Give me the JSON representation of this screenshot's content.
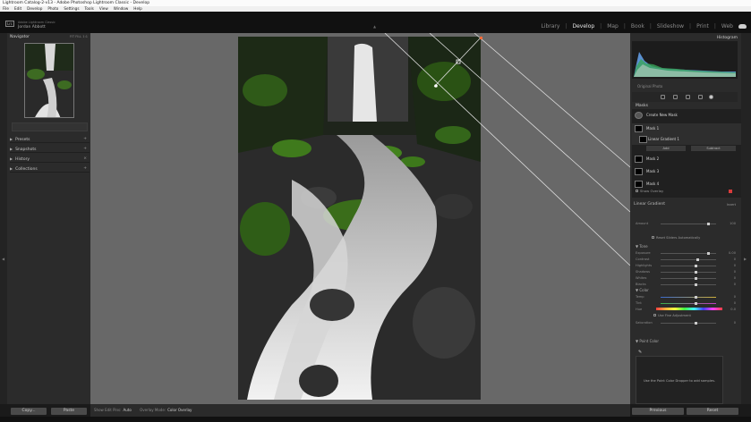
{
  "titlebar": {
    "title": "Lightroom Catalog-2-v13 - Adobe Photoshop Lightroom Classic - Develop"
  },
  "menu": [
    "File",
    "Edit",
    "Develop",
    "Photo",
    "Settings",
    "Tools",
    "View",
    "Window",
    "Help"
  ],
  "identity": {
    "logo": "Lrc",
    "subtitle": "Adobe Lightroom Classic",
    "name": "Jordan Abbott"
  },
  "modules": [
    "Library",
    "Develop",
    "Map",
    "Book",
    "Slideshow",
    "Print",
    "Web"
  ],
  "active_module": "Develop",
  "left_panel": {
    "navigator": {
      "title": "Navigator",
      "zoom": "FIT  FILL  1:1"
    },
    "sections": [
      "Presets",
      "Snapshots",
      "History",
      "Collections"
    ],
    "copy_label": "Copy...",
    "paste_label": "Paste"
  },
  "right_panel": {
    "histogram_title": "Histogram",
    "original_photo_label": "Original Photo",
    "masks_title": "Masks",
    "create_new_mask": "Create New Mask",
    "masks": [
      {
        "name": "Mask 1",
        "sub": "Linear Gradient 1"
      },
      {
        "name": "Mask 2"
      },
      {
        "name": "Mask 3"
      },
      {
        "name": "Mask 4"
      }
    ],
    "add_label": "Add",
    "subtract_label": "Subtract",
    "show_overlay": "Show Overlay",
    "color_gradient_title": "Linear Gradient",
    "invert_label": "Invert",
    "amount_label": "Amount",
    "reset_sliders": "Reset Sliders Automatically",
    "tone_title": "Tone",
    "tone_sliders": [
      {
        "label": "Exposure",
        "value": "0.00"
      },
      {
        "label": "Contrast",
        "value": "0"
      },
      {
        "label": "Highlights",
        "value": "0"
      },
      {
        "label": "Shadows",
        "value": "0"
      },
      {
        "label": "Whites",
        "value": "0"
      },
      {
        "label": "Blacks",
        "value": "0"
      }
    ],
    "color_title": "Color",
    "color_sliders": [
      {
        "label": "Temp",
        "value": "0"
      },
      {
        "label": "Tint",
        "value": "0"
      },
      {
        "label": "Hue",
        "value": "0.0"
      },
      {
        "label": "Saturation",
        "value": "0"
      }
    ],
    "fine_adjust": "Use Fine Adjustment",
    "point_color_title": "Point Color",
    "point_color_hint": "Use the Point Color Dropper to add samples.",
    "previous_label": "Previous",
    "reset_label": "Reset"
  },
  "toolbar": {
    "show_edit_pins_label": "Show Edit Pins:",
    "show_edit_pins_value": "Auto",
    "overlay_mode_label": "Overlay Mode:",
    "overlay_mode_value": "Color Overlay"
  }
}
